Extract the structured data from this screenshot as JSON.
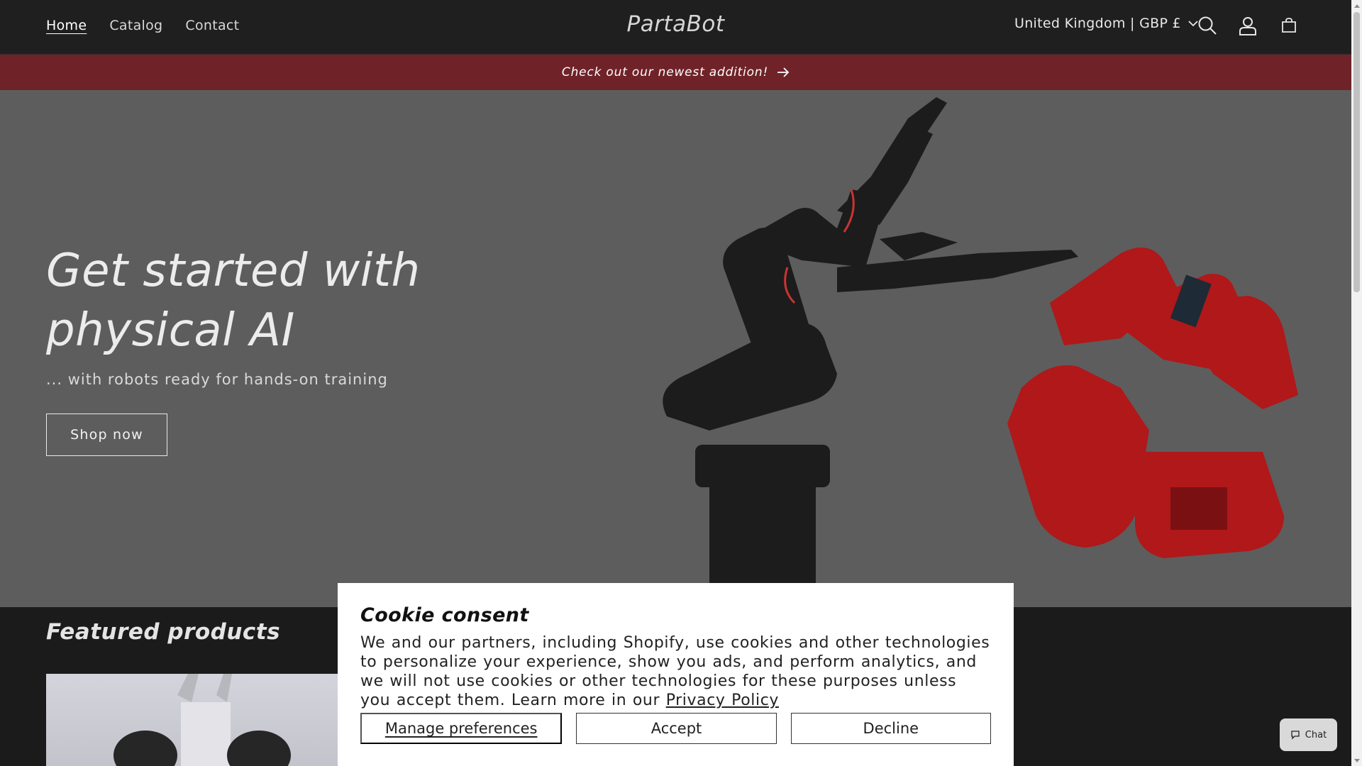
{
  "header": {
    "nav": [
      {
        "label": "Home",
        "active": true
      },
      {
        "label": "Catalog",
        "active": false
      },
      {
        "label": "Contact",
        "active": false
      }
    ],
    "logo": "PartaBot",
    "locale": "United Kingdom | GBP £",
    "icons": [
      "search-icon",
      "account-icon",
      "cart-icon"
    ]
  },
  "announcement": {
    "text": "Check out our newest addition!",
    "icon": "arrow-right-icon",
    "background": "#6f2328"
  },
  "hero": {
    "title": "Get started with physical AI",
    "subtitle": "... with robots ready for hands-on training",
    "button": "Shop now"
  },
  "featured": {
    "title": "Featured products"
  },
  "cookie": {
    "title": "Cookie consent",
    "body": "We and our partners, including Shopify, use cookies and other technologies to personalize your experience, show you ads, and perform analytics, and we will not use cookies or other technologies for these purposes unless you accept them. Learn more in our ",
    "link": "Privacy Policy",
    "manage": "Manage preferences",
    "accept": "Accept",
    "decline": "Decline"
  },
  "chat": {
    "label": "Chat",
    "icon": "chat-bubble-icon"
  },
  "colors": {
    "header_bg": "#1f1f1f",
    "hero_bg": "#5d5d5d",
    "robot_red": "#b0181a"
  }
}
